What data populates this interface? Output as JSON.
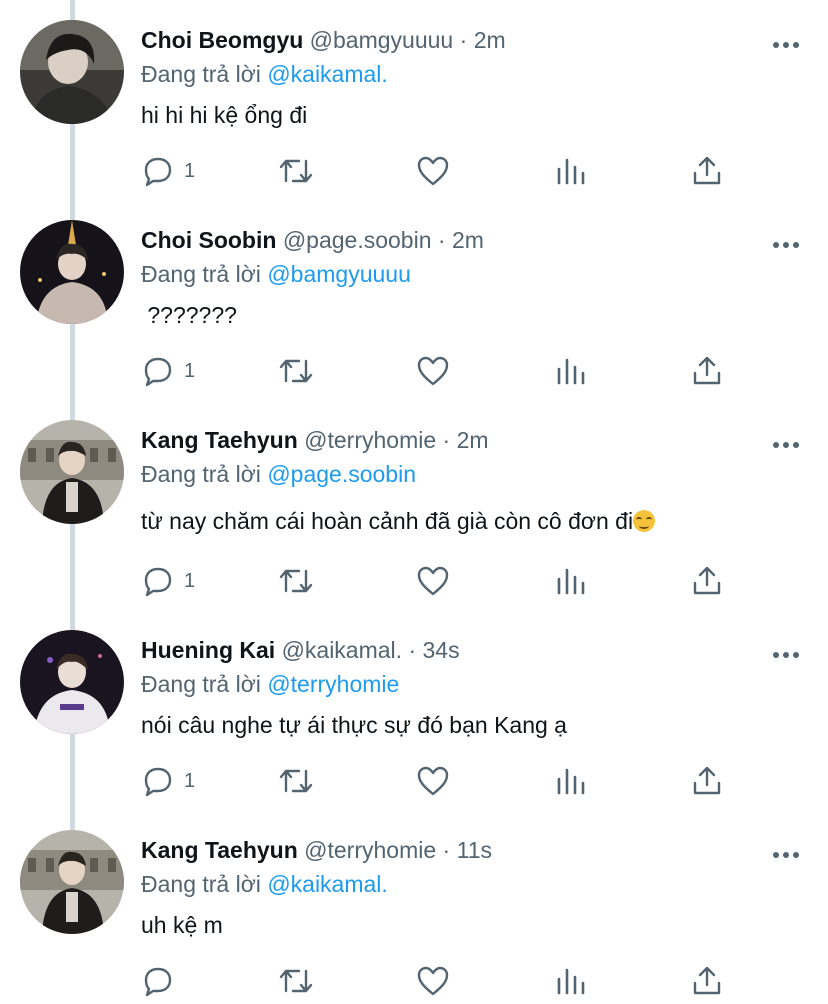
{
  "icons": {
    "reply": "speech-bubble-icon",
    "retweet": "retweet-icon",
    "like": "heart-icon",
    "views": "bar-chart-icon",
    "share": "share-upload-icon",
    "more": "ellipsis-icon"
  },
  "colors": {
    "mention": "#1d9bf0",
    "secondary_text": "#536471",
    "thread_line": "#cfd9de"
  },
  "tweets": [
    {
      "name": "Choi Beomgyu",
      "handle": "@bamgyuuuu",
      "separator": "·",
      "time": "2m",
      "reply_prefix": "Đang trả lời",
      "reply_to": "@kaikamal.",
      "text": "hi hi hi kệ ổng đi",
      "reply_count": "1"
    },
    {
      "name": "Choi Soobin",
      "handle": "@page.soobin",
      "separator": "·",
      "time": "2m",
      "reply_prefix": "Đang trả lời",
      "reply_to": "@bamgyuuuu",
      "text": " ???????",
      "reply_count": "1"
    },
    {
      "name": "Kang Taehyun",
      "handle": "@terryhomie",
      "separator": "·",
      "time": "2m",
      "reply_prefix": "Đang trả lời",
      "reply_to": "@page.soobin",
      "text": "từ nay chăm cái hoàn cảnh đã già còn cô đơn đi",
      "emoji": "smirking-face-emoji",
      "reply_count": "1"
    },
    {
      "name": "Huening Kai",
      "handle": "@kaikamal.",
      "separator": "·",
      "time": "34s",
      "reply_prefix": "Đang trả lời",
      "reply_to": "@terryhomie",
      "text": "nói câu nghe tự ái thực sự đó bạn Kang ạ",
      "reply_count": "1"
    },
    {
      "name": "Kang Taehyun",
      "handle": "@terryhomie",
      "separator": "·",
      "time": "11s",
      "reply_prefix": "Đang trả lời",
      "reply_to": "@kaikamal.",
      "text": "uh kệ m",
      "reply_count": ""
    }
  ]
}
